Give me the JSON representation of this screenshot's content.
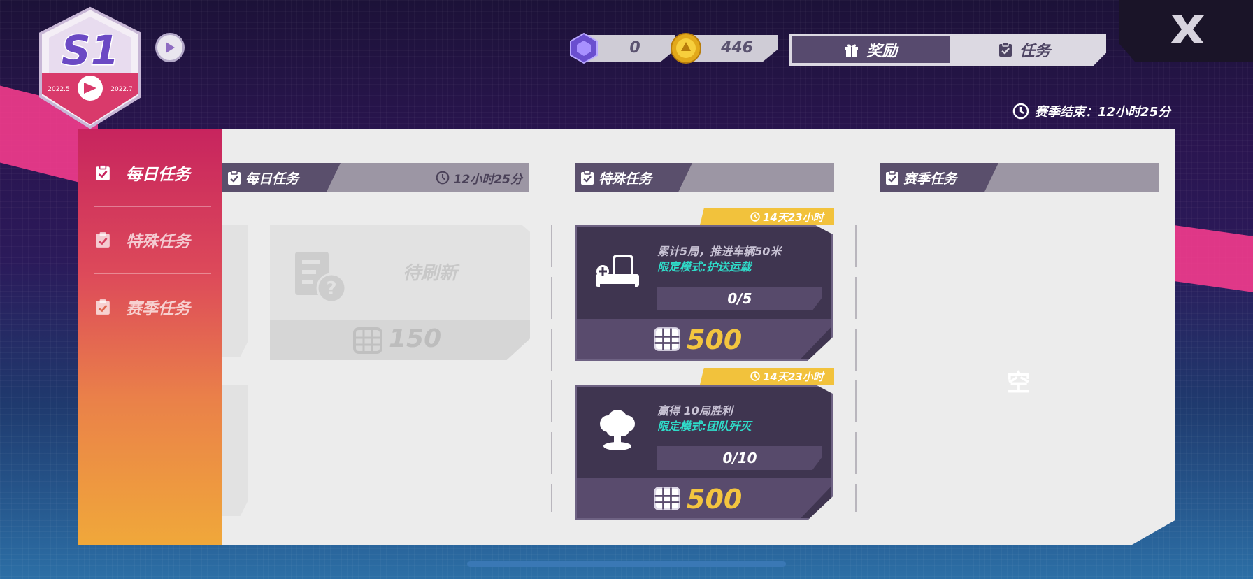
{
  "badge": {
    "season": "S1",
    "start": "2022.5",
    "end": "2022.7"
  },
  "currencies": [
    {
      "name": "crystal",
      "icon": "crystal-icon",
      "value": "0"
    },
    {
      "name": "coin",
      "icon": "coin-icon",
      "value": "446"
    }
  ],
  "tabs": {
    "rewards": "奖励",
    "tasks": "任务",
    "active": "rewards"
  },
  "season_end": {
    "label": "赛季结束：12小时25分"
  },
  "sidebar": {
    "items": [
      {
        "label": "每日任务",
        "active": true
      },
      {
        "label": "特殊任务",
        "active": false
      },
      {
        "label": "赛季任务",
        "active": false
      }
    ]
  },
  "daily": {
    "title": "每日任务",
    "timer": "12小时25分",
    "refresh_card": {
      "label": "待刷新",
      "reward": "150"
    }
  },
  "special": {
    "title": "特殊任务",
    "tasks": [
      {
        "deadline": "14天23小时",
        "desc": "累计5局，推进车辆50米",
        "mode": "限定模式:护送运载",
        "progress": "0/5",
        "reward": "500",
        "icon": "vehicle-icon"
      },
      {
        "deadline": "14天23小时",
        "desc": "赢得 10局胜利",
        "mode": "限定模式:团队歼灭",
        "progress": "0/10",
        "reward": "500",
        "icon": "explosion-icon"
      }
    ]
  },
  "season": {
    "title": "赛季任务",
    "empty": "空"
  },
  "colors": {
    "accent_pink": "#c7245e",
    "accent_orange": "#f0a83a",
    "card_dark": "#3f3550",
    "gold": "#f3c53f",
    "teal": "#2fdcc9"
  }
}
